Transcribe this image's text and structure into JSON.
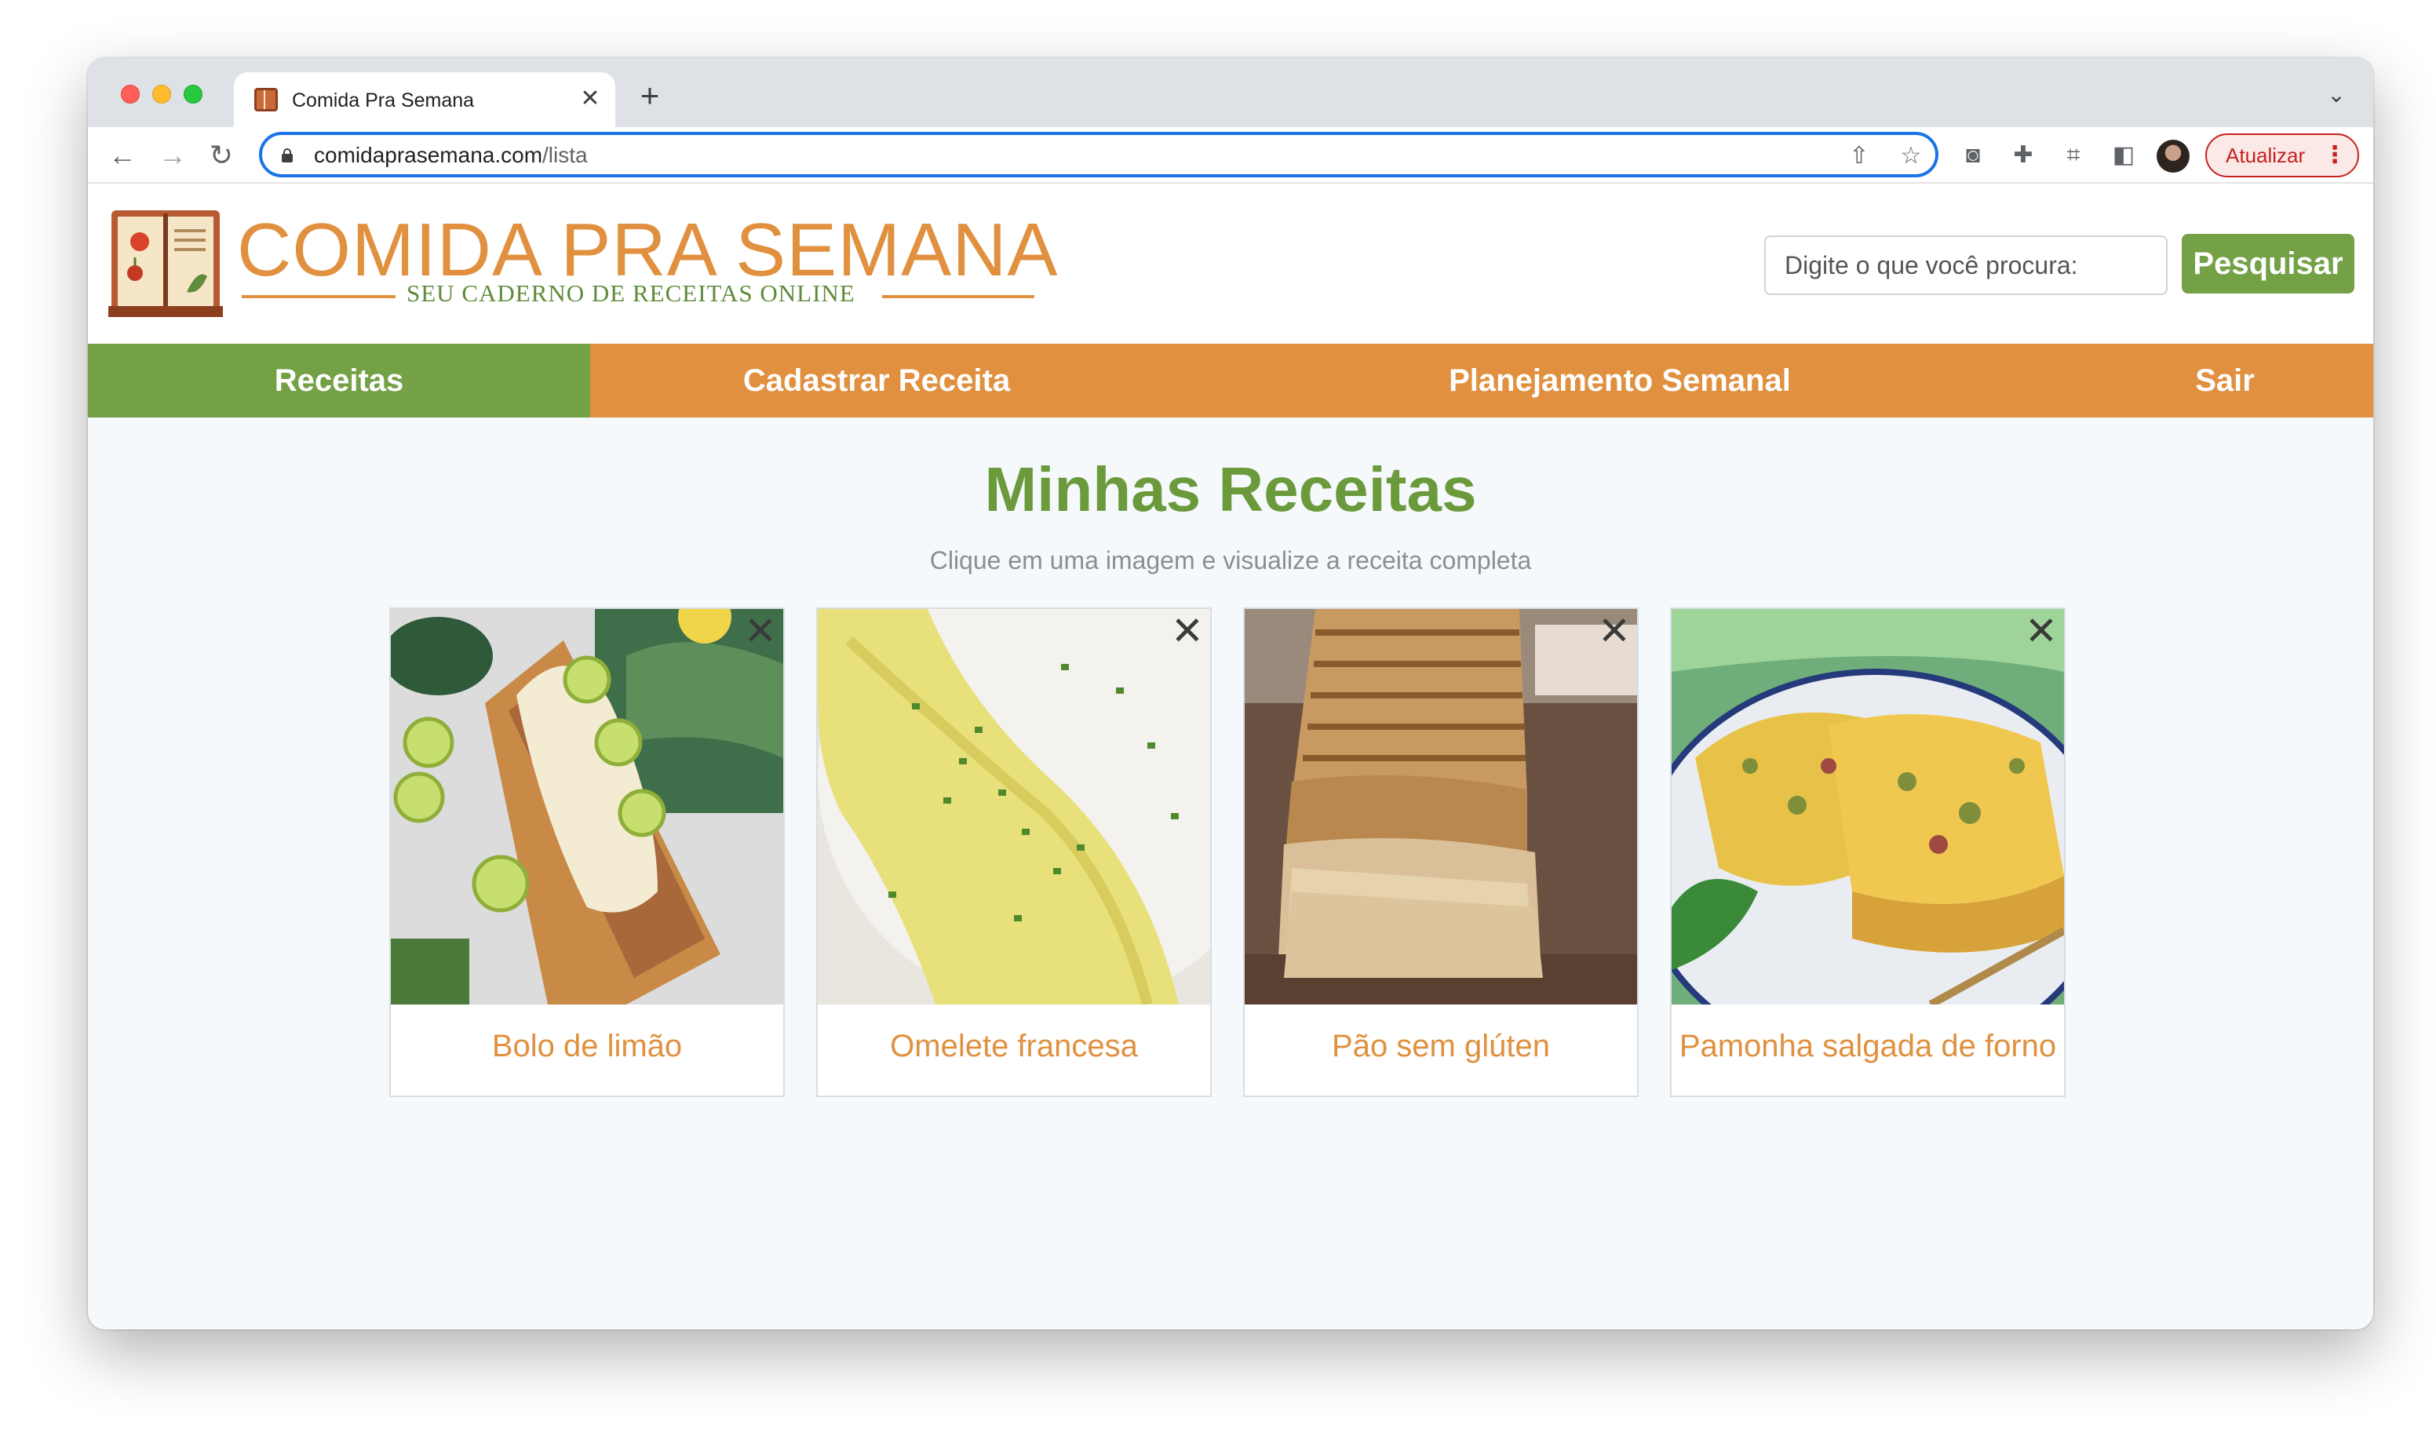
{
  "browser": {
    "tab_title": "Comida Pra Semana",
    "tab_close": "✕",
    "new_tab": "+",
    "url_host": "comidaprasemana.com",
    "url_path": "/lista",
    "update_label": "Atualizar",
    "update_menu": "⋮"
  },
  "header": {
    "brand_title": "COMIDA PRA SEMANA",
    "brand_subtitle": "SEU CADERNO DE RECEITAS ONLINE",
    "search_placeholder": "Digite o que você procura:",
    "search_button": "Pesquisar"
  },
  "nav": {
    "items": [
      {
        "label": "Receitas",
        "active": true
      },
      {
        "label": "Cadastrar Receita"
      },
      {
        "label": "Planejamento Semanal"
      },
      {
        "label": "Sair"
      }
    ]
  },
  "main": {
    "title": "Minhas Receitas",
    "subtitle": "Clique em uma imagem e visualize a receita completa",
    "cards": [
      {
        "title": "Bolo de limão"
      },
      {
        "title": "Omelete francesa"
      },
      {
        "title": "Pão sem glúten"
      },
      {
        "title": "Pamonha salgada de forno"
      }
    ],
    "remove_label": "✕"
  }
}
